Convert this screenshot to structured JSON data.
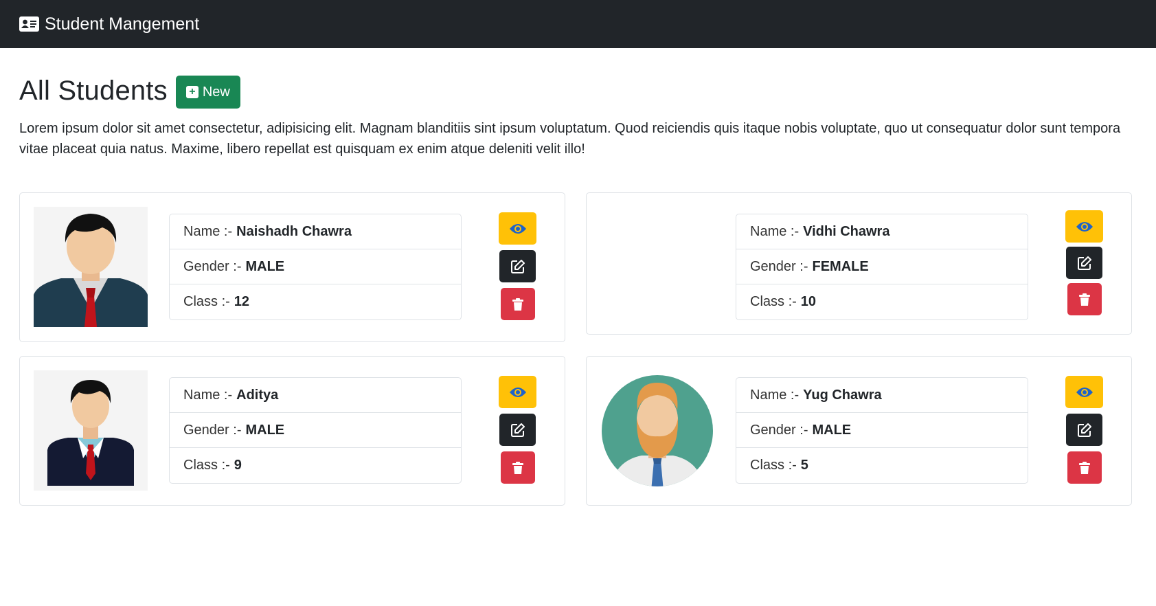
{
  "navbar": {
    "brand": "Student Mangement",
    "icon": "id-card-icon"
  },
  "page": {
    "title": "All Students",
    "new_button": "New",
    "intro": "Lorem ipsum dolor sit amet consectetur, adipisicing elit. Magnam blanditiis sint ipsum voluptatum. Quod reiciendis quis itaque nobis voluptate, quo ut consequatur dolor sunt tempora vitae placeat quia natus. Maxime, libero repellat est quisquam ex enim atque deleniti velit illo!"
  },
  "labels": {
    "name": "Name :-",
    "gender": "Gender :-",
    "class": "Class :-"
  },
  "students": [
    {
      "name": "Naishadh Chawra",
      "gender": "MALE",
      "class": "12"
    },
    {
      "name": "Vidhi Chawra",
      "gender": "FEMALE",
      "class": "10"
    },
    {
      "name": "Aditya",
      "gender": "MALE",
      "class": "9"
    },
    {
      "name": "Yug Chawra",
      "gender": "MALE",
      "class": "5"
    }
  ],
  "colors": {
    "navbar": "#212529",
    "new": "#198754",
    "view": "#ffc107",
    "edit": "#212529",
    "delete": "#dc3545",
    "eye": "#1e63c9"
  }
}
